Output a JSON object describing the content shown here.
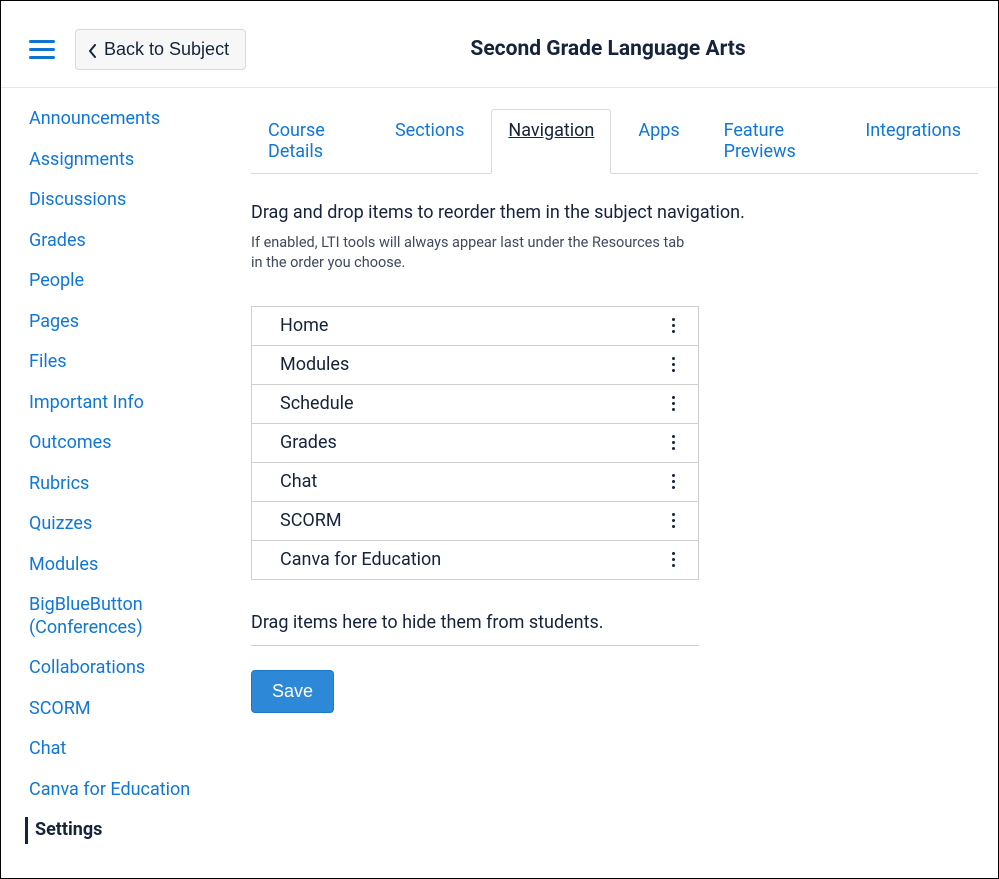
{
  "header": {
    "back_label": "Back to Subject",
    "course_title": "Second Grade Language Arts"
  },
  "sidebar": {
    "items": [
      {
        "label": "Announcements",
        "active": false
      },
      {
        "label": "Assignments",
        "active": false
      },
      {
        "label": "Discussions",
        "active": false
      },
      {
        "label": "Grades",
        "active": false
      },
      {
        "label": "People",
        "active": false
      },
      {
        "label": "Pages",
        "active": false
      },
      {
        "label": "Files",
        "active": false
      },
      {
        "label": "Important Info",
        "active": false
      },
      {
        "label": "Outcomes",
        "active": false
      },
      {
        "label": "Rubrics",
        "active": false
      },
      {
        "label": "Quizzes",
        "active": false
      },
      {
        "label": "Modules",
        "active": false
      },
      {
        "label": "BigBlueButton (Conferences)",
        "active": false
      },
      {
        "label": "Collaborations",
        "active": false
      },
      {
        "label": "SCORM",
        "active": false
      },
      {
        "label": "Chat",
        "active": false
      },
      {
        "label": "Canva for Education",
        "active": false
      },
      {
        "label": "Settings",
        "active": true
      }
    ]
  },
  "tabs": [
    {
      "label": "Course Details",
      "active": false
    },
    {
      "label": "Sections",
      "active": false
    },
    {
      "label": "Navigation",
      "active": true
    },
    {
      "label": "Apps",
      "active": false
    },
    {
      "label": "Feature Previews",
      "active": false
    },
    {
      "label": "Integrations",
      "active": false
    }
  ],
  "instructions": "Drag and drop items to reorder them in the subject navigation.",
  "sub_instructions": "If enabled, LTI tools will always appear last under the Resources tab in the order you choose.",
  "nav_items": [
    {
      "label": "Home"
    },
    {
      "label": "Modules"
    },
    {
      "label": "Schedule"
    },
    {
      "label": "Grades"
    },
    {
      "label": "Chat"
    },
    {
      "label": "SCORM"
    },
    {
      "label": "Canva for Education"
    }
  ],
  "hide_label": "Drag items here to hide them from students.",
  "save_label": "Save"
}
